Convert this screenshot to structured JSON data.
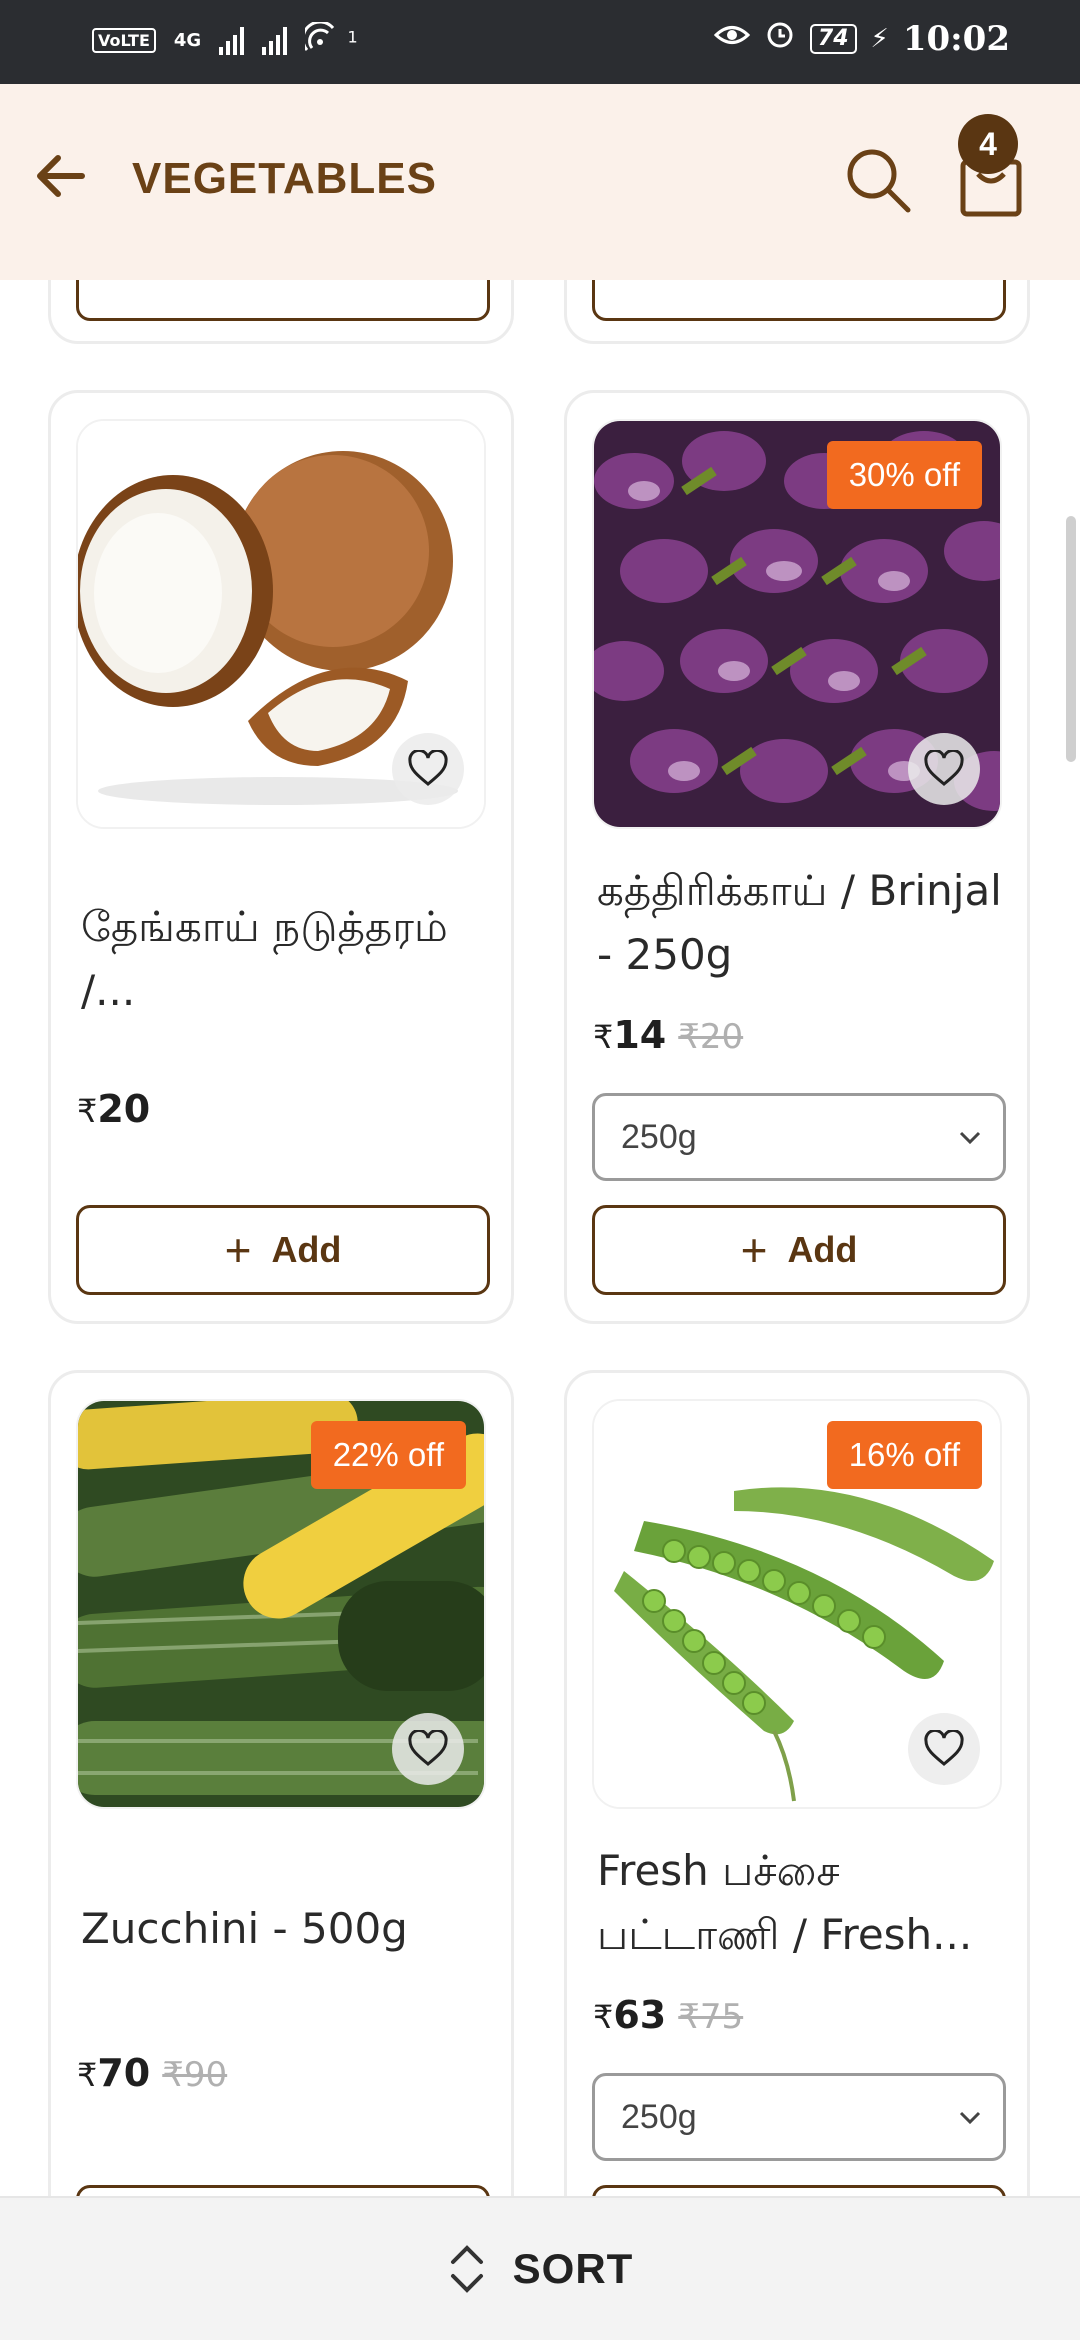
{
  "status_bar": {
    "volte": "VoLTE",
    "network": "4G",
    "signal_sup": "1",
    "battery": "74",
    "time": "10:02"
  },
  "header": {
    "title": "VEGETABLES",
    "cart_count": "4"
  },
  "products": [
    {
      "name": "தேங்காய் நடுத்தரம் /...",
      "price_symbol": "₹",
      "price": "20",
      "add_label": "Add"
    },
    {
      "name": "கத்திரிக்காய் / Brinjal - 250g",
      "discount": "30% off",
      "price_symbol": "₹",
      "price": "14",
      "mrp": "₹20",
      "variant": "250g",
      "add_label": "Add"
    },
    {
      "name": "Zucchini - 500g",
      "discount": "22% off",
      "price_symbol": "₹",
      "price": "70",
      "mrp": "₹90"
    },
    {
      "name": "Fresh பச்சை பட்டாணி / Fresh...",
      "discount": "16% off",
      "price_symbol": "₹",
      "price": "63",
      "mrp": "₹75",
      "variant": "250g"
    }
  ],
  "sort": {
    "label": "SORT"
  },
  "colors": {
    "accent": "#5a3612",
    "discount": "#f26a1f",
    "header_bg": "#fbf1ea"
  }
}
